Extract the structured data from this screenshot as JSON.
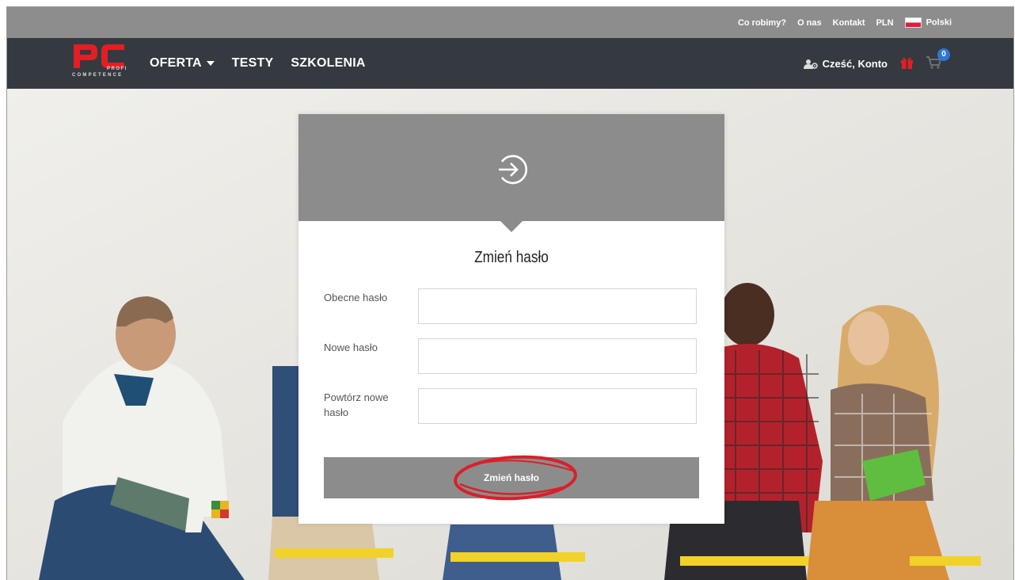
{
  "topbar": {
    "links": [
      "Co robimy?",
      "O nas",
      "Kontakt",
      "PLN"
    ],
    "language": "Polski"
  },
  "brand": {
    "logo_letters": "pC",
    "profi": "PROFI",
    "competence": "COMPETENCE"
  },
  "nav": {
    "offer": "OFERTA",
    "tests": "TESTY",
    "trainings": "SZKOLENIA",
    "account": "Cześć, Konto",
    "cart_count": "0"
  },
  "form": {
    "title": "Zmień hasło",
    "fields": [
      {
        "label": "Obecne hasło",
        "value": ""
      },
      {
        "label": "Nowe hasło",
        "value": ""
      },
      {
        "label": "Powtórz nowe hasło",
        "value": ""
      }
    ],
    "submit_label": "Zmień hasło"
  },
  "colors": {
    "topbar": "#8d8d8d",
    "navbar": "#343a40",
    "brand_red": "#e31e24",
    "card_header": "#8c8c8c",
    "highlight_ring": "#d8202a",
    "badge": "#2f76d3"
  },
  "icons": {
    "login": "login-arrow-icon",
    "account": "user-gear-icon",
    "gift": "gift-icon",
    "cart": "cart-icon",
    "flag": "poland-flag-icon"
  }
}
